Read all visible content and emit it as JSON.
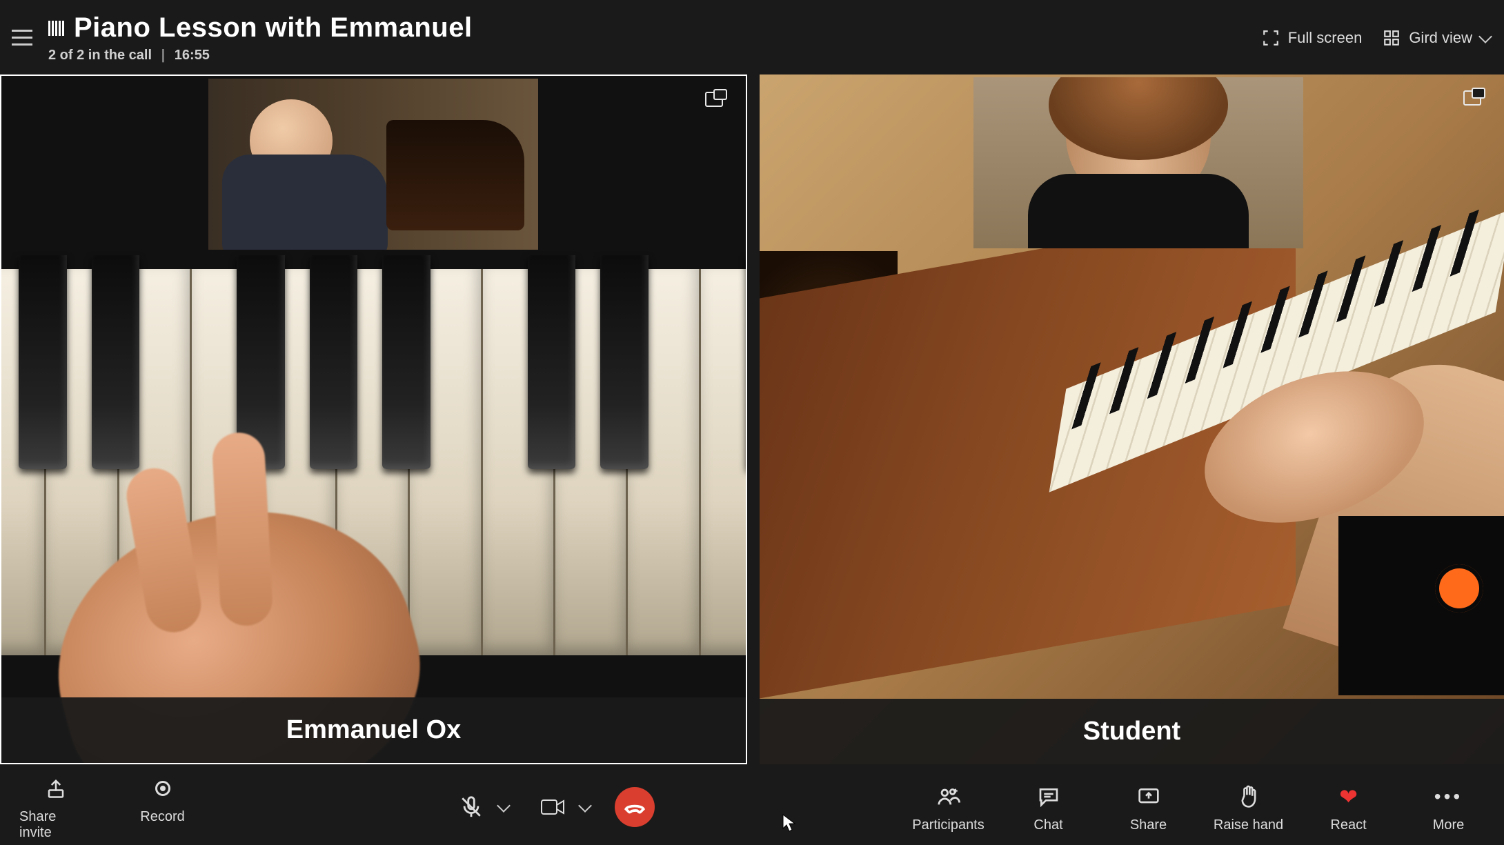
{
  "header": {
    "title": "Piano Lesson with Emmanuel",
    "participants_count": "2 of 2 in the call",
    "duration": "16:55",
    "fullscreen_label": "Full screen",
    "view_label": "Gird view"
  },
  "tiles": [
    {
      "id": "tile-left",
      "name": "Emmanuel Ox",
      "pinned": true
    },
    {
      "id": "tile-right",
      "name": "Student",
      "pinned": false
    }
  ],
  "toolbar": {
    "left": {
      "share_invite": "Share invite",
      "record": "Record"
    },
    "center": {
      "mic_muted": true,
      "camera_on": true,
      "hangup": "End call"
    },
    "right": {
      "participants": "Participants",
      "chat": "Chat",
      "share": "Share",
      "raise_hand": "Raise hand",
      "react": "React",
      "more": "More"
    }
  },
  "colors": {
    "hangup": "#d93e2e",
    "react_heart": "#e03535",
    "background": "#1a1a1a"
  }
}
